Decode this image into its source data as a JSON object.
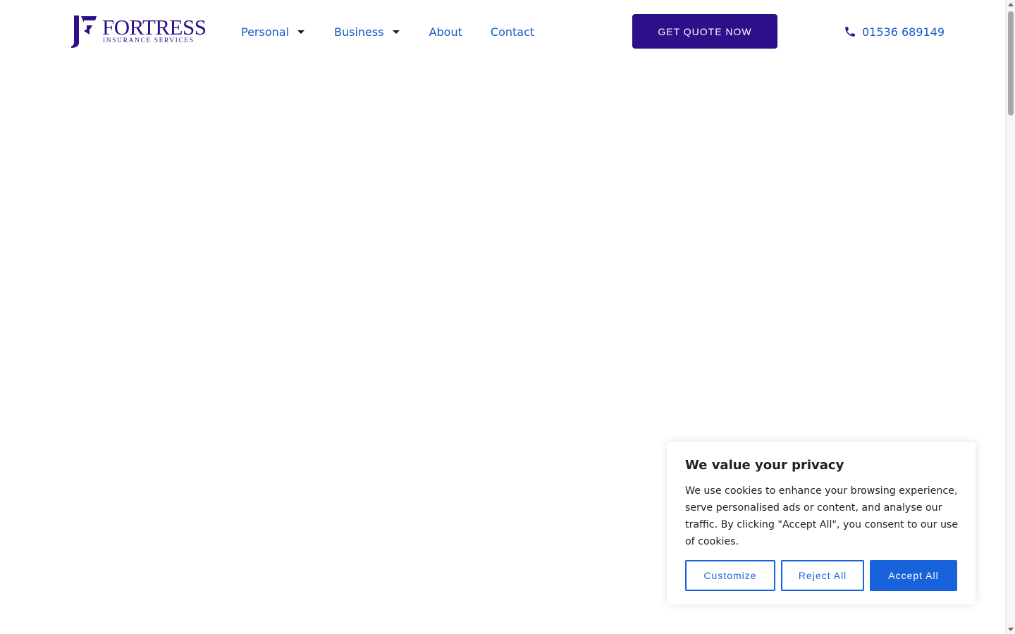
{
  "header": {
    "logo": {
      "name": "FORTRESS",
      "tagline": "INSURANCE SERVICES"
    },
    "nav": [
      {
        "label": "Personal",
        "has_dropdown": true
      },
      {
        "label": "Business",
        "has_dropdown": true
      },
      {
        "label": "About",
        "has_dropdown": false
      },
      {
        "label": "Contact",
        "has_dropdown": false
      }
    ],
    "cta_label": "GET QUOTE NOW",
    "phone": {
      "icon": "phone-icon",
      "number": "01536 689149"
    }
  },
  "cookie_banner": {
    "title": "We value your privacy",
    "text": "We use cookies to enhance your browsing experience, serve personalised ads or content, and analyse our traffic. By clicking \"Accept All\", you consent to our use of cookies.",
    "buttons": {
      "customize": "Customize",
      "reject": "Reject All",
      "accept": "Accept All"
    }
  },
  "colors": {
    "brand": "#2e0f8a",
    "link": "#1658c8",
    "cookie_accent": "#1863dc"
  }
}
